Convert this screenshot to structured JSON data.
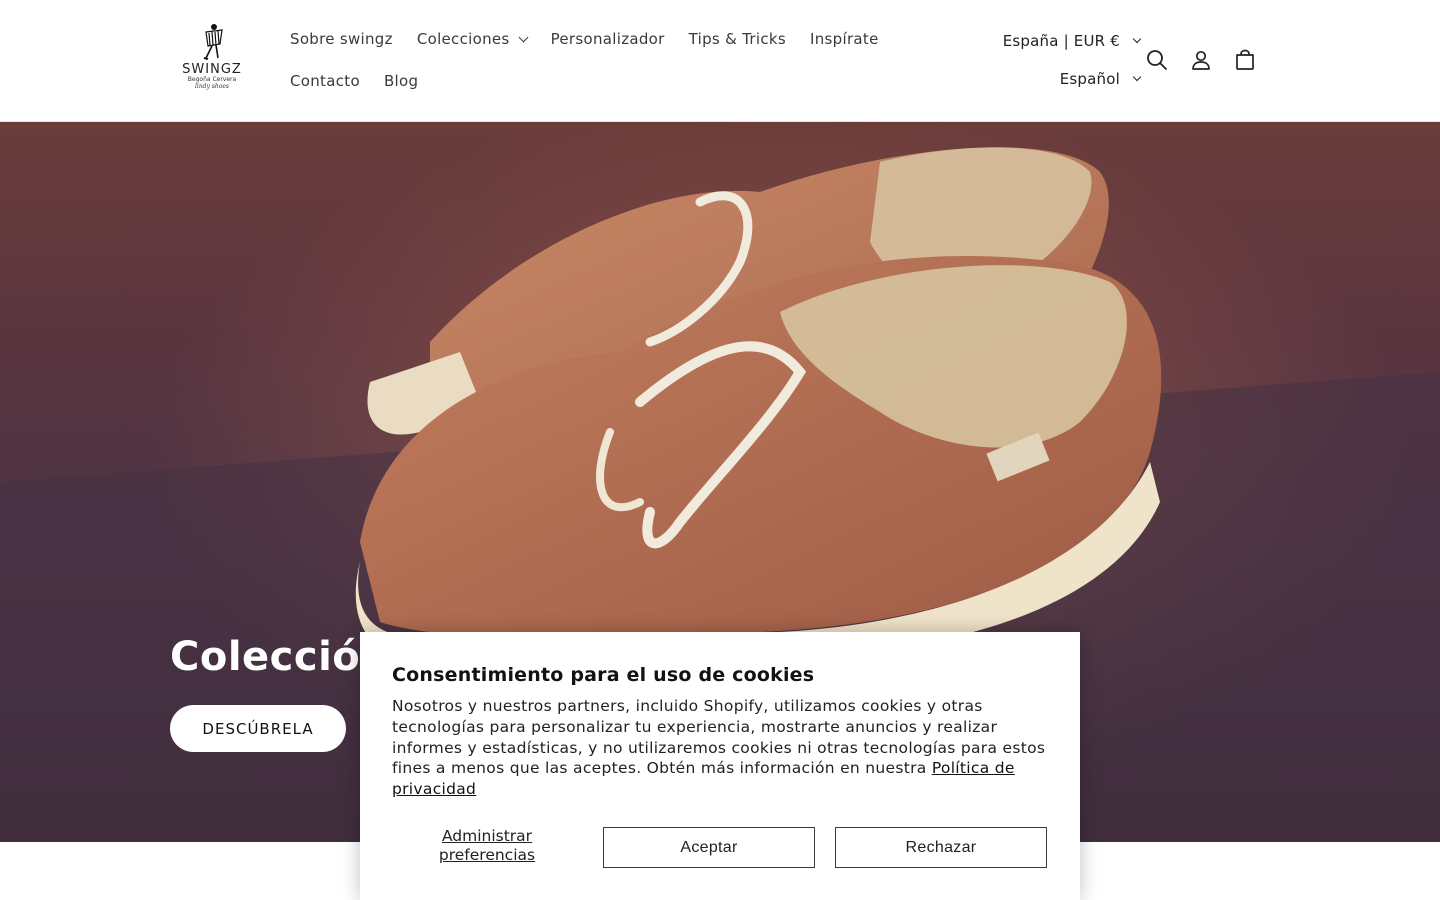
{
  "brand": {
    "name": "SWINGZ",
    "subtitle": "Begoña Cervera",
    "tagline": "lindy shoes"
  },
  "nav": {
    "row1": [
      {
        "label": "Sobre swingz",
        "has_dropdown": false
      },
      {
        "label": "Colecciones",
        "has_dropdown": true
      },
      {
        "label": "Personalizador",
        "has_dropdown": false
      },
      {
        "label": "Tips & Tricks",
        "has_dropdown": false
      },
      {
        "label": "Inspírate",
        "has_dropdown": false
      }
    ],
    "row2": [
      {
        "label": "Contacto",
        "has_dropdown": false
      },
      {
        "label": "Blog",
        "has_dropdown": false
      }
    ]
  },
  "locale": {
    "country": "España | EUR €",
    "language": "Español"
  },
  "header_icons": [
    "search-icon",
    "account-icon",
    "cart-icon"
  ],
  "hero": {
    "title": "Colección",
    "button_label": "DESCÚBRELA"
  },
  "cookie": {
    "title": "Consentimiento para el uso de cookies",
    "body": "Nosotros y nuestros partners, incluido Shopify, utilizamos cookies y otras tecnologías para personalizar tu experiencia, mostrarte anuncios y realizar informes y estadísticas, y no utilizaremos cookies ni otras tecnologías para estos fines a menos que las aceptes. Obtén más información en nuestra",
    "link": "Política de privacidad",
    "manage_label": "Administrar preferencias",
    "accept_label": "Aceptar",
    "reject_label": "Rechazar"
  },
  "colors": {
    "text": "#121212",
    "hero_dark": "#3a2a35",
    "shoe": "#b8765a",
    "white": "#ffffff"
  }
}
